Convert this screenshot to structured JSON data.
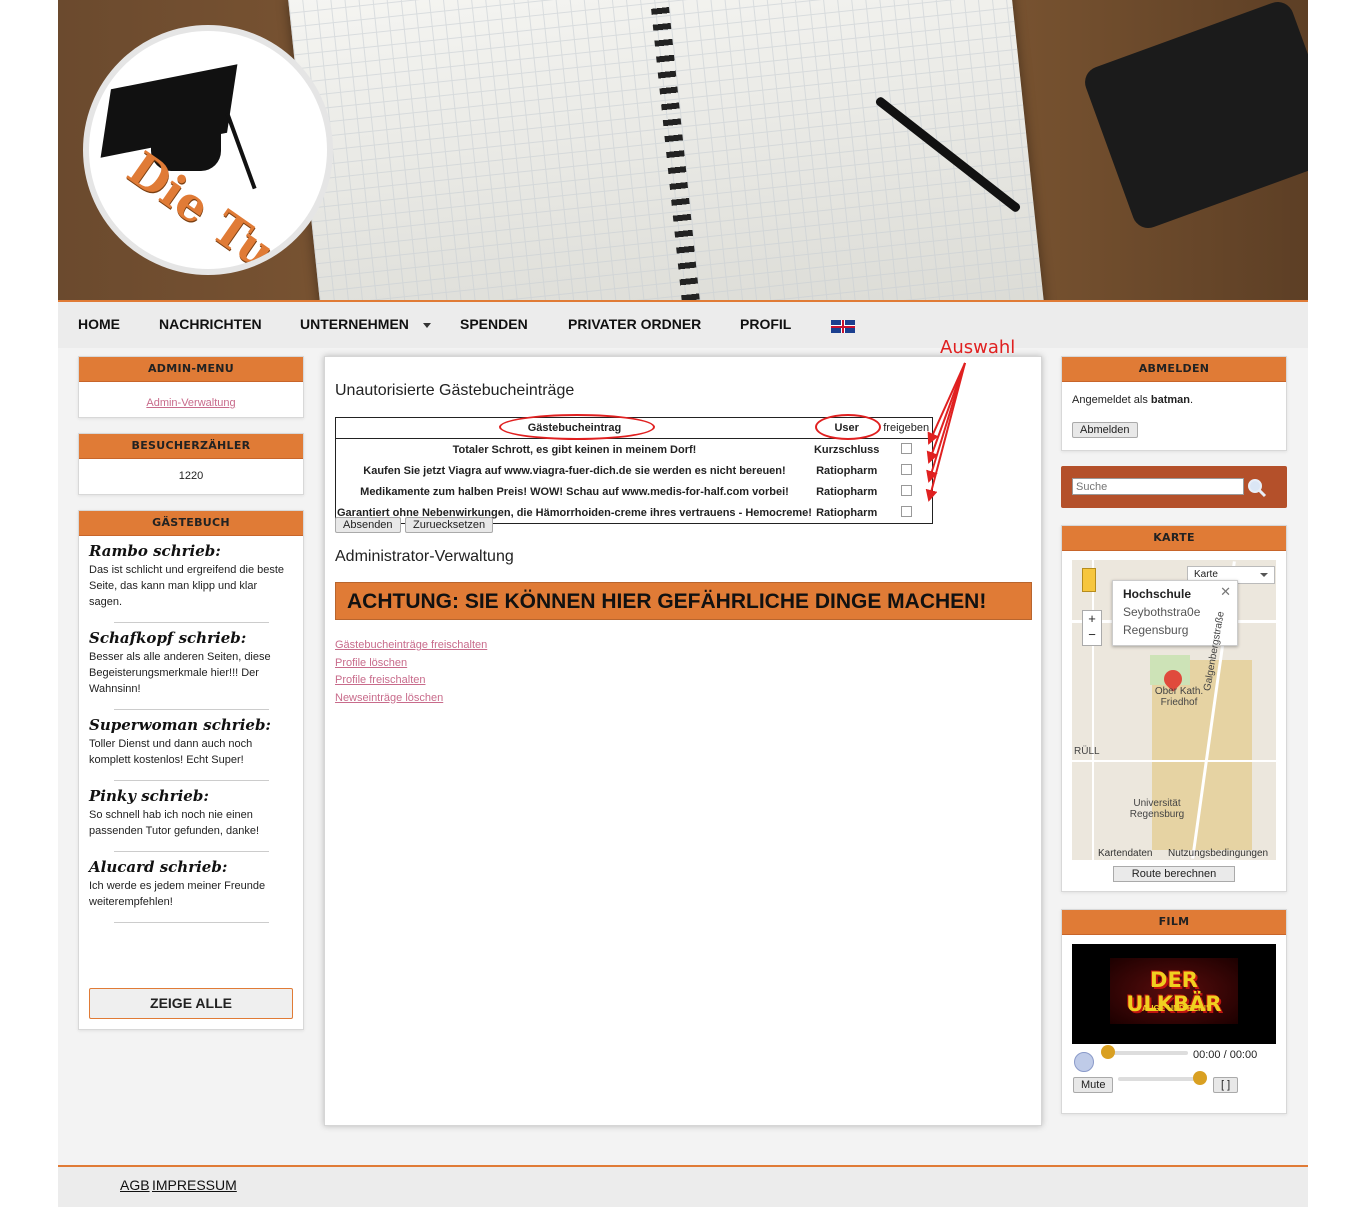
{
  "brand": {
    "logo_text": "Die Tutoren AG"
  },
  "nav": {
    "items": [
      "HOME",
      "NACHRICHTEN",
      "UNTERNEHMEN",
      "SPENDEN",
      "PRIVATER ORDNER",
      "PROFIL"
    ],
    "language_flag": "uk-flag-icon"
  },
  "left": {
    "admin_menu": {
      "title": "ADMIN-MENU",
      "link": "Admin-Verwaltung"
    },
    "counter": {
      "title": "BESUCHERZÄHLER",
      "value": "1220"
    },
    "guestbook": {
      "title": "GÄSTEBUCH",
      "entries": [
        {
          "name": "Rambo schrieb:",
          "text": "Das ist schlicht und ergreifend die beste Seite, das kann man klipp und klar sagen."
        },
        {
          "name": "Schafkopf schrieb:",
          "text": "Besser als alle anderen Seiten, diese Begeisterungsmerkmale hier!!! Der Wahnsinn!"
        },
        {
          "name": "Superwoman schrieb:",
          "text": "Toller Dienst und dann auch noch komplett kostenlos! Echt Super!"
        },
        {
          "name": "Pinky schrieb:",
          "text": "So schnell hab ich noch nie einen passenden Tutor gefunden, danke!"
        },
        {
          "name": "Alucard schrieb:",
          "text": "Ich werde es jedem meiner Freunde weiterempfehlen!"
        }
      ],
      "show_all": "ZEIGE ALLE"
    }
  },
  "main": {
    "heading": "Unautorisierte Gästebucheinträge",
    "table": {
      "headers": [
        "Gästebucheintrag",
        "User",
        "freigeben"
      ],
      "rows": [
        {
          "entry": "Totaler Schrott, es gibt keinen in meinem Dorf!",
          "user": "Kurzschluss"
        },
        {
          "entry": "Kaufen Sie jetzt Viagra auf www.viagra-fuer-dich.de sie werden es nicht bereuen!",
          "user": "Ratiopharm"
        },
        {
          "entry": "Medikamente zum halben Preis! WOW! Schau auf www.medis-for-half.com vorbei!",
          "user": "Ratiopharm"
        },
        {
          "entry": "Garantiert ohne Nebenwirkungen, die Hämorrhoiden-creme ihres vertrauens - Hemocreme!",
          "user": "Ratiopharm"
        }
      ]
    },
    "submit": "Absenden",
    "reset": "Zuruecksetzen",
    "admin_heading": "Administrator-Verwaltung",
    "warning": "ACHTUNG: SIE KÖNNEN HIER GEFÄHRLICHE DINGE MACHEN!",
    "admin_links": [
      "Gästebucheinträge freischalten",
      "Profile löschen",
      "Profile freischalten",
      "Newseinträge löschen"
    ],
    "annotation": "Auswahl"
  },
  "right": {
    "logout": {
      "title": "ABMELDEN",
      "prefix": "Angemeldet als",
      "user": "batman",
      "button": "Abmelden"
    },
    "search": {
      "placeholder": "Suche",
      "icon": "search-icon"
    },
    "map": {
      "title": "KARTE",
      "type_select": "Karte",
      "popup_title": "Hochschule",
      "popup_line1": "Seybothstra0e",
      "popup_line2": "Regensburg",
      "labels": [
        "Ober Kath. Friedhof",
        "Galgenbergstraße",
        "Universität Regensburg",
        "RÜLL"
      ],
      "footer_left": "Kartendaten",
      "footer_right": "Nutzungsbedingungen",
      "route_button": "Route berechnen"
    },
    "film": {
      "title": "FILM",
      "video_title": "DER ULKBÄR",
      "video_subtitle": "\"AUGE UND BEIN\"",
      "time": "00:00 / 00:00",
      "mute": "Mute",
      "fullscreen": "[ ]"
    }
  },
  "footer": {
    "links": [
      "AGB",
      "IMPRESSUM"
    ]
  },
  "colors": {
    "accent": "#e07b36",
    "link": "#c86b8b",
    "annotation": "#e02020"
  }
}
